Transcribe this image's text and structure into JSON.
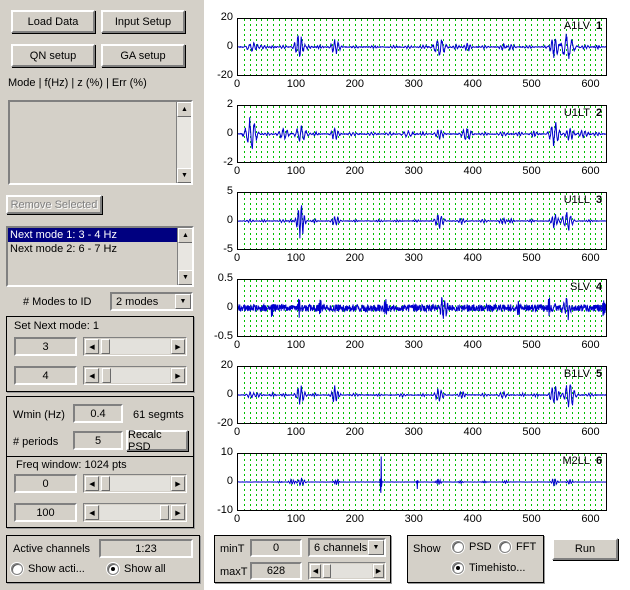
{
  "window": {
    "bg": "#d4d0c8",
    "accent": "#000080"
  },
  "toolbar": {
    "load_data_label": "Load Data",
    "input_setup_label": "Input Setup",
    "qn_setup_label": "QN setup",
    "ga_setup_label": "GA setup"
  },
  "modes_table": {
    "header": "Mode  |  f(Hz)  |  z (%)  |  Err (%)",
    "rows": [],
    "remove_selected_label": "Remove Selected"
  },
  "next_modes": {
    "items": [
      {
        "label": "Next mode 1: 3 - 4 Hz",
        "selected": true
      },
      {
        "label": "Next mode 2: 6 - 7 Hz",
        "selected": false
      }
    ],
    "num_modes_label": "# Modes to ID",
    "num_modes_value": "2 modes",
    "num_modes_options": [
      "2 modes"
    ]
  },
  "set_next_mode": {
    "title": "Set Next mode:  1",
    "low_value": "3",
    "high_value": "4"
  },
  "psd": {
    "wmin_label": "Wmin (Hz)",
    "wmin_value": "0.4",
    "segments_label": "61 segmts",
    "periods_label": "# periods",
    "periods_value": "5",
    "recalc_label": "Recalc PSD",
    "freq_window_label": "Freq window: 1024 pts",
    "freq_low_value": "0",
    "freq_high_value": "100"
  },
  "channels": {
    "active_channels_label": "Active channels",
    "active_channels_value": "1:23",
    "show_active_label": "Show acti...",
    "show_active_selected": false,
    "show_all_label": "Show all",
    "show_all_selected": true
  },
  "time_controls": {
    "min_t_label": "minT",
    "min_t_value": "0",
    "max_t_label": "maxT",
    "max_t_value": "628",
    "channels_value": "6 channels",
    "channels_options": [
      "6 channels"
    ]
  },
  "show_controls": {
    "title": "Show",
    "psd_label": "PSD",
    "psd_selected": false,
    "fft_label": "FFT",
    "fft_selected": false,
    "timehistory_label": "Timehisto...",
    "timehistory_selected": true
  },
  "run_button": {
    "label": "Run"
  },
  "chart_data": {
    "type": "line",
    "title": "",
    "xlabel": "",
    "ylabel": "",
    "xlim": [
      0,
      628
    ],
    "xticks": [
      0,
      100,
      200,
      300,
      400,
      500,
      600
    ],
    "grid": true,
    "grid_color": "#00c000",
    "trace_color": "#0000cc",
    "panels": [
      {
        "index": "1",
        "name": "A1LV",
        "ylim": [
          -20,
          20
        ],
        "yticks": [
          20,
          0,
          -20
        ],
        "noise": 0.012,
        "bursts": [
          {
            "t": 22,
            "a": 0.11,
            "w": 9
          },
          {
            "t": 32,
            "a": 0.09,
            "w": 7
          },
          {
            "t": 44,
            "a": 0.05,
            "w": 6
          },
          {
            "t": 60,
            "a": 0.04,
            "w": 5
          },
          {
            "t": 78,
            "a": 0.05,
            "w": 6
          },
          {
            "t": 104,
            "a": 0.42,
            "w": 7
          },
          {
            "t": 120,
            "a": 0.06,
            "w": 6
          },
          {
            "t": 140,
            "a": 0.05,
            "w": 5
          },
          {
            "t": 166,
            "a": 0.24,
            "w": 7
          },
          {
            "t": 200,
            "a": 0.04,
            "w": 6
          },
          {
            "t": 232,
            "a": 0.04,
            "w": 6
          },
          {
            "t": 266,
            "a": 0.05,
            "w": 6
          },
          {
            "t": 290,
            "a": 0.05,
            "w": 6
          },
          {
            "t": 316,
            "a": 0.05,
            "w": 6
          },
          {
            "t": 344,
            "a": 0.32,
            "w": 9
          },
          {
            "t": 372,
            "a": 0.07,
            "w": 6
          },
          {
            "t": 392,
            "a": 0.12,
            "w": 6
          },
          {
            "t": 420,
            "a": 0.05,
            "w": 6
          },
          {
            "t": 452,
            "a": 0.09,
            "w": 6
          },
          {
            "t": 466,
            "a": 0.09,
            "w": 6
          },
          {
            "t": 496,
            "a": 0.05,
            "w": 6
          },
          {
            "t": 524,
            "a": 0.04,
            "w": 5
          },
          {
            "t": 540,
            "a": 0.3,
            "w": 7
          },
          {
            "t": 562,
            "a": 0.34,
            "w": 11
          },
          {
            "t": 592,
            "a": 0.06,
            "w": 6
          },
          {
            "t": 614,
            "a": 0.05,
            "w": 5
          }
        ]
      },
      {
        "index": "2",
        "name": "U1LT",
        "ylim": [
          -2,
          2
        ],
        "yticks": [
          2,
          0,
          -2
        ],
        "noise": 0.012,
        "bursts": [
          {
            "t": 22,
            "a": 0.46,
            "w": 9
          },
          {
            "t": 50,
            "a": 0.05,
            "w": 6
          },
          {
            "t": 78,
            "a": 0.18,
            "w": 8
          },
          {
            "t": 108,
            "a": 0.24,
            "w": 9
          },
          {
            "t": 132,
            "a": 0.05,
            "w": 6
          },
          {
            "t": 166,
            "a": 0.17,
            "w": 7
          },
          {
            "t": 196,
            "a": 0.06,
            "w": 7
          },
          {
            "t": 228,
            "a": 0.05,
            "w": 7
          },
          {
            "t": 258,
            "a": 0.05,
            "w": 7
          },
          {
            "t": 290,
            "a": 0.1,
            "w": 9
          },
          {
            "t": 316,
            "a": 0.05,
            "w": 6
          },
          {
            "t": 344,
            "a": 0.14,
            "w": 7
          },
          {
            "t": 390,
            "a": 0.22,
            "w": 8
          },
          {
            "t": 420,
            "a": 0.05,
            "w": 6
          },
          {
            "t": 452,
            "a": 0.07,
            "w": 7
          },
          {
            "t": 480,
            "a": 0.06,
            "w": 6
          },
          {
            "t": 506,
            "a": 0.1,
            "w": 6
          },
          {
            "t": 540,
            "a": 0.34,
            "w": 8
          },
          {
            "t": 566,
            "a": 0.2,
            "w": 7
          },
          {
            "t": 590,
            "a": 0.13,
            "w": 7
          },
          {
            "t": 612,
            "a": 0.06,
            "w": 6
          }
        ]
      },
      {
        "index": "3",
        "name": "U1LL",
        "ylim": [
          -5,
          5
        ],
        "yticks": [
          5,
          0,
          -5
        ],
        "noise": 0.008,
        "bursts": [
          {
            "t": 20,
            "a": 0.05,
            "w": 6
          },
          {
            "t": 44,
            "a": 0.04,
            "w": 5
          },
          {
            "t": 76,
            "a": 0.05,
            "w": 6
          },
          {
            "t": 90,
            "a": 0.04,
            "w": 5
          },
          {
            "t": 107,
            "a": 0.48,
            "w": 6
          },
          {
            "t": 130,
            "a": 0.05,
            "w": 5
          },
          {
            "t": 166,
            "a": 0.18,
            "w": 6
          },
          {
            "t": 200,
            "a": 0.04,
            "w": 5
          },
          {
            "t": 240,
            "a": 0.04,
            "w": 5
          },
          {
            "t": 272,
            "a": 0.04,
            "w": 5
          },
          {
            "t": 304,
            "a": 0.04,
            "w": 5
          },
          {
            "t": 344,
            "a": 0.24,
            "w": 7
          },
          {
            "t": 382,
            "a": 0.09,
            "w": 6
          },
          {
            "t": 420,
            "a": 0.06,
            "w": 6
          },
          {
            "t": 452,
            "a": 0.1,
            "w": 6
          },
          {
            "t": 466,
            "a": 0.07,
            "w": 5
          },
          {
            "t": 500,
            "a": 0.05,
            "w": 5
          },
          {
            "t": 540,
            "a": 0.22,
            "w": 6
          },
          {
            "t": 562,
            "a": 0.3,
            "w": 8
          },
          {
            "t": 600,
            "a": 0.05,
            "w": 5
          }
        ]
      },
      {
        "index": "4",
        "name": "SLV",
        "ylim": [
          -0.5,
          0.5
        ],
        "yticks": [
          0.5,
          0,
          -0.5
        ],
        "noise": 0.13,
        "bursts": [
          {
            "t": 58,
            "a": 0.35,
            "w": 2
          },
          {
            "t": 104,
            "a": 0.3,
            "w": 2
          },
          {
            "t": 140,
            "a": 0.32,
            "w": 2
          },
          {
            "t": 252,
            "a": 0.28,
            "w": 3
          },
          {
            "t": 350,
            "a": 0.36,
            "w": 6
          },
          {
            "t": 478,
            "a": 0.3,
            "w": 3
          },
          {
            "t": 530,
            "a": 0.4,
            "w": 2
          },
          {
            "t": 560,
            "a": 0.34,
            "w": 6
          },
          {
            "t": 624,
            "a": 0.38,
            "w": 2
          }
        ]
      },
      {
        "index": "5",
        "name": "B1LV",
        "ylim": [
          -20,
          20
        ],
        "yticks": [
          20,
          0,
          -20
        ],
        "noise": 0.01,
        "bursts": [
          {
            "t": 22,
            "a": 0.09,
            "w": 7
          },
          {
            "t": 34,
            "a": 0.07,
            "w": 6
          },
          {
            "t": 60,
            "a": 0.05,
            "w": 5
          },
          {
            "t": 78,
            "a": 0.05,
            "w": 5
          },
          {
            "t": 106,
            "a": 0.28,
            "w": 7
          },
          {
            "t": 130,
            "a": 0.05,
            "w": 5
          },
          {
            "t": 166,
            "a": 0.26,
            "w": 6
          },
          {
            "t": 200,
            "a": 0.05,
            "w": 6
          },
          {
            "t": 240,
            "a": 0.04,
            "w": 5
          },
          {
            "t": 280,
            "a": 0.06,
            "w": 6
          },
          {
            "t": 316,
            "a": 0.04,
            "w": 5
          },
          {
            "t": 344,
            "a": 0.22,
            "w": 7
          },
          {
            "t": 382,
            "a": 0.11,
            "w": 6
          },
          {
            "t": 420,
            "a": 0.05,
            "w": 6
          },
          {
            "t": 452,
            "a": 0.09,
            "w": 7
          },
          {
            "t": 486,
            "a": 0.05,
            "w": 5
          },
          {
            "t": 508,
            "a": 0.05,
            "w": 5
          },
          {
            "t": 540,
            "a": 0.34,
            "w": 7
          },
          {
            "t": 566,
            "a": 0.4,
            "w": 8
          },
          {
            "t": 600,
            "a": 0.06,
            "w": 6
          }
        ]
      },
      {
        "index": "6",
        "name": "M2LL",
        "ylim": [
          -10,
          10
        ],
        "yticks": [
          10,
          0,
          -10
        ],
        "noise": 0.004,
        "bursts": [
          {
            "t": 72,
            "a": 0.03,
            "w": 4
          },
          {
            "t": 92,
            "a": 0.07,
            "w": 5
          },
          {
            "t": 108,
            "a": 0.11,
            "w": 6
          },
          {
            "t": 168,
            "a": 0.09,
            "w": 4
          },
          {
            "t": 244,
            "a": 0.95,
            "w": 1
          },
          {
            "t": 306,
            "a": 0.2,
            "w": 1
          },
          {
            "t": 342,
            "a": 0.09,
            "w": 4
          },
          {
            "t": 380,
            "a": 0.04,
            "w": 4
          },
          {
            "t": 420,
            "a": 0.04,
            "w": 4
          },
          {
            "t": 456,
            "a": 0.05,
            "w": 4
          },
          {
            "t": 540,
            "a": 0.12,
            "w": 5
          },
          {
            "t": 566,
            "a": 0.08,
            "w": 5
          }
        ]
      }
    ]
  }
}
